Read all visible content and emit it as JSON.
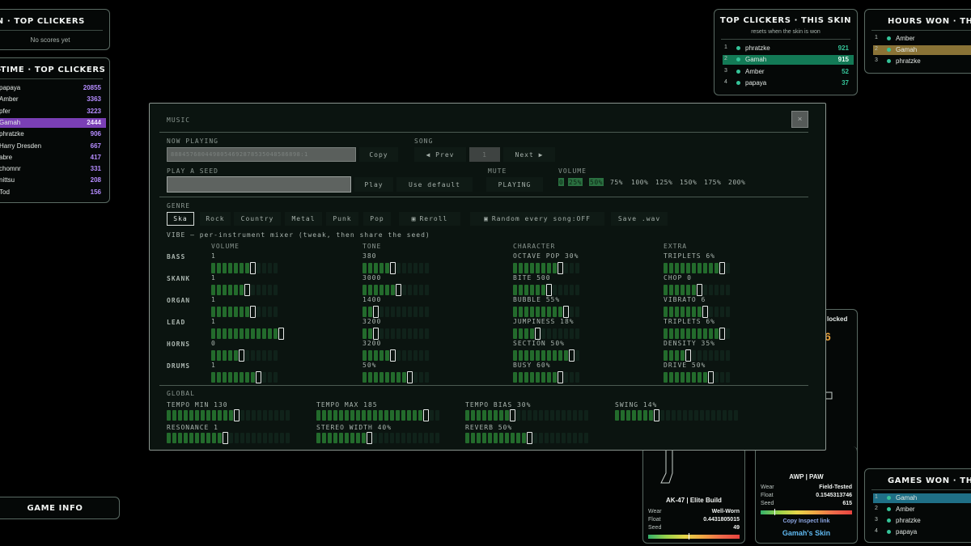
{
  "session_panel": {
    "title": "SESSION · TOP CLICKERS",
    "empty": "No scores yet"
  },
  "alltime_panel": {
    "title": "ALL-TIME · TOP CLICKERS",
    "rows": [
      {
        "name": "papaya",
        "score": "20855"
      },
      {
        "name": "Amber",
        "score": "3363"
      },
      {
        "name": "pfer",
        "score": "3223"
      },
      {
        "name": "Gamah",
        "score": "2444"
      },
      {
        "name": "phratzke",
        "score": "906"
      },
      {
        "name": "Harry Dresden",
        "score": "667"
      },
      {
        "name": "abre",
        "score": "417"
      },
      {
        "name": "chomnr",
        "score": "331"
      },
      {
        "name": "nittsu",
        "score": "208"
      },
      {
        "name": "Tod",
        "score": "156"
      }
    ]
  },
  "game_info": {
    "label": "GAME INFO"
  },
  "skin_panel": {
    "title": "TOP CLICKERS · THIS SKIN",
    "subtitle": "resets when the skin is won",
    "rows": [
      {
        "rank": "1",
        "name": "phratzke",
        "score": "921"
      },
      {
        "rank": "2",
        "name": "Gamah",
        "score": "915"
      },
      {
        "rank": "3",
        "name": "Amber",
        "score": "52"
      },
      {
        "rank": "4",
        "name": "papaya",
        "score": "37"
      }
    ]
  },
  "hours_panel": {
    "title": "HOURS WON · THIS SKIN",
    "rows": [
      {
        "rank": "1",
        "name": "Amber"
      },
      {
        "rank": "2",
        "name": "Gamah"
      },
      {
        "rank": "3",
        "name": "phratzke"
      }
    ]
  },
  "games_panel": {
    "title": "GAMES WON · THIS SKIN",
    "rows": [
      {
        "rank": "1",
        "name": "Gamah"
      },
      {
        "rank": "2",
        "name": "Amber"
      },
      {
        "rank": "3",
        "name": "phratzke"
      },
      {
        "rank": "4",
        "name": "papaya"
      }
    ]
  },
  "cards": {
    "locked_label": "locked",
    "partial_digit": "6",
    "ak": {
      "title": "AK-47 | Elite Build",
      "wear_label": "Wear",
      "wear": "Well-Worn",
      "float_label": "Float",
      "float": "0.4431805015",
      "seed_label": "Seed",
      "seed": "49",
      "float_fraction": 0.4431805015
    },
    "awp": {
      "title": "AWP | PAW",
      "wear_label": "Wear",
      "wear": "Field-Tested",
      "float_label": "Float",
      "float": "0.1545313746",
      "seed_label": "Seed",
      "seed": "615",
      "float_fraction": 0.1545313746,
      "inspect_link": "Copy Inspect link",
      "owner": "Gamah's Skin"
    }
  },
  "music": {
    "title": "MUSIC",
    "close": "×",
    "now_playing_label": "NOW PLAYING",
    "now_playing_value": "8884576804498054692878535048586898:1",
    "copy": "Copy",
    "song_label": "SONG",
    "prev": "◀ Prev",
    "song_number": "1",
    "next": "Next ▶",
    "seed_label": "PLAY A SEED",
    "play": "Play",
    "use_default": "Use default",
    "mute_label": "MUTE",
    "mute_value": "PLAYING",
    "volume_label": "VOLUME",
    "volume_options": [
      "0",
      "25%",
      "50%",
      "75%",
      "100%",
      "125%",
      "150%",
      "175%",
      "200%"
    ],
    "volume_selected": "50%",
    "genre_label": "GENRE",
    "genres": [
      "Ska",
      "Rock",
      "Country",
      "Metal",
      "Punk",
      "Pop"
    ],
    "genre_selected": "Ska",
    "reroll": "Reroll",
    "random_every_song": "Random every song:OFF",
    "save_wav": "Save .wav",
    "vibe_text": "VIBE — per-instrument mixer (tweak, then share the seed)",
    "columns": [
      "VOLUME",
      "TONE",
      "CHARACTER",
      "EXTRA"
    ],
    "instruments": [
      {
        "name": "BASS",
        "params": [
          {
            "label": "1",
            "value": 0.62
          },
          {
            "label": "380",
            "value": 0.38
          },
          {
            "label": "OCTAVE POP 30%",
            "value": 0.7
          },
          {
            "label": "TRIPLETS 6%",
            "value": 0.82
          }
        ]
      },
      {
        "name": "SKANK",
        "params": [
          {
            "label": "1",
            "value": 0.5
          },
          {
            "label": "3000",
            "value": 0.5
          },
          {
            "label": "BITE 500",
            "value": 0.5
          },
          {
            "label": "CHOP 0",
            "value": 0.5
          }
        ]
      },
      {
        "name": "ORGAN",
        "params": [
          {
            "label": "1",
            "value": 0.62
          },
          {
            "label": "1400",
            "value": 0.18
          },
          {
            "label": "BUBBLE 55%",
            "value": 0.72
          },
          {
            "label": "VIBRATO 6",
            "value": 0.62
          }
        ]
      },
      {
        "name": "LEAD",
        "params": [
          {
            "label": "1",
            "value": 1.0
          },
          {
            "label": "3200",
            "value": 0.18
          },
          {
            "label": "JUMPINESS 18%",
            "value": 0.32
          },
          {
            "label": "TRIPLETS 6%",
            "value": 0.82
          }
        ]
      },
      {
        "name": "HORNS",
        "params": [
          {
            "label": "0",
            "value": 0.42
          },
          {
            "label": "3200",
            "value": 0.42
          },
          {
            "label": "SECTION 50%",
            "value": 0.82
          },
          {
            "label": "DENSITY 35%",
            "value": 0.35
          }
        ]
      },
      {
        "name": "DRUMS",
        "params": [
          {
            "label": "1",
            "value": 0.67
          },
          {
            "label": "50%",
            "value": 0.67
          },
          {
            "label": "BUSY 60%",
            "value": 0.67
          },
          {
            "label": "DRIVE 50%",
            "value": 0.67
          }
        ]
      }
    ],
    "global_label": "GLOBAL",
    "globals": [
      {
        "label": "TEMPO MIN 130",
        "value": 0.53
      },
      {
        "label": "TEMPO MAX 185",
        "value": 0.85
      },
      {
        "label": "TEMPO BIAS 30%",
        "value": 0.38
      },
      {
        "label": "SWING 14%",
        "value": 0.3
      },
      {
        "label": "RESONANCE 1",
        "value": 0.45
      },
      {
        "label": "STEREO WIDTH 40%",
        "value": 0.42
      },
      {
        "label": "REVERB 50%",
        "value": 0.5
      }
    ]
  },
  "colors": {
    "accent_green": "#35c499",
    "purple_score": "#b58cff",
    "highlight_purple": "#7a3fb5",
    "highlight_teal": "#137a56",
    "highlight_gold": "#8a7336",
    "highlight_blue": "#1f6f86",
    "slider_on": "#236b2c"
  }
}
